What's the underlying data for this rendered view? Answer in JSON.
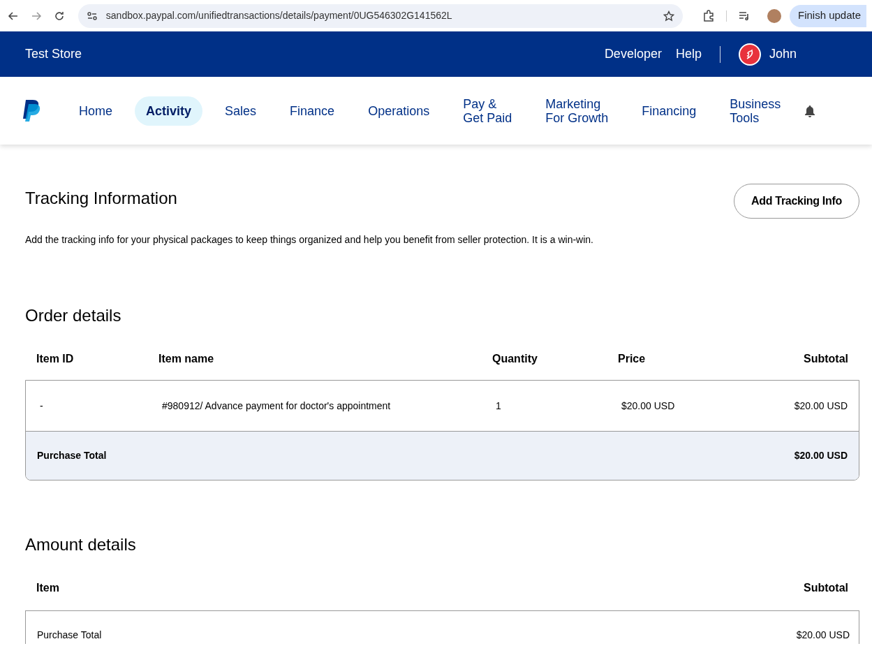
{
  "browser": {
    "url": "sandbox.paypal.com/unifiedtransactions/details/payment/0UG546302G141562L",
    "update_button": "Finish update"
  },
  "header": {
    "store": "Test Store",
    "links": [
      "Developer",
      "Help"
    ],
    "user": "John"
  },
  "nav": {
    "items": [
      {
        "label": "Home",
        "selected": false
      },
      {
        "label": "Activity",
        "selected": true
      },
      {
        "label": "Sales",
        "selected": false
      },
      {
        "label": "Finance",
        "selected": false
      },
      {
        "label": "Operations",
        "selected": false
      },
      {
        "label": "Pay &\nGet Paid",
        "selected": false
      },
      {
        "label": "Marketing\nFor Growth",
        "selected": false
      },
      {
        "label": "Financing",
        "selected": false
      },
      {
        "label": "Business\nTools",
        "selected": false
      }
    ]
  },
  "tracking": {
    "title": "Tracking Information",
    "button": "Add Tracking Info",
    "description": "Add the tracking info for your physical packages to keep things organized and help you benefit from seller protection. It is a win-win."
  },
  "order": {
    "title": "Order details",
    "columns": [
      "Item ID",
      "Item name",
      "Quantity",
      "Price",
      "Subtotal"
    ],
    "rows": [
      {
        "cells": [
          "-",
          "#980912/ Advance payment for doctor's appointment",
          "1",
          "$20.00 USD",
          "$20.00 USD"
        ]
      }
    ],
    "total": {
      "label": "Purchase Total",
      "value": "$20.00 USD"
    }
  },
  "amount": {
    "title": "Amount details",
    "columns": [
      "Item",
      "Subtotal"
    ],
    "rows": [
      {
        "label": "Purchase Total",
        "value": "$20.00 USD"
      }
    ]
  }
}
